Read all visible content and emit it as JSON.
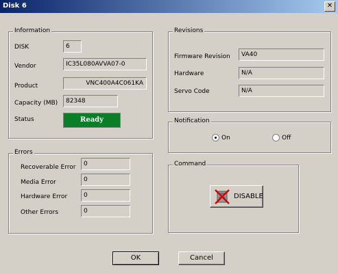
{
  "window": {
    "title": "Disk 6",
    "close_glyph": "✕"
  },
  "information": {
    "legend": "Information",
    "disk_label": "DISK",
    "disk_value": "6",
    "vendor_label": "Vendor",
    "vendor_value": "IC35L080AVVA07-0",
    "product_label": "Product",
    "product_value": "VNC400A4C061KA",
    "capacity_label": "Capacity (MB)",
    "capacity_value": "82348",
    "status_label": "Status",
    "status_value": "Ready",
    "status_color": "#0b7e28"
  },
  "errors": {
    "legend": "Errors",
    "items": [
      {
        "label": "Recoverable Error",
        "value": "0"
      },
      {
        "label": "Media Error",
        "value": "0"
      },
      {
        "label": "Hardware Error",
        "value": "0"
      },
      {
        "label": "Other Errors",
        "value": "0"
      }
    ]
  },
  "revisions": {
    "legend": "Revisions",
    "firmware_label": "Firmware Revision",
    "firmware_value": "VA40",
    "hardware_label": "Hardware",
    "hardware_value": "N/A",
    "servo_label": "Servo Code",
    "servo_value": "N/A"
  },
  "notification": {
    "legend": "Notification",
    "on_label": "On",
    "off_label": "Off",
    "selected": "On"
  },
  "command": {
    "legend": "Command",
    "disable_label": "DISABLE",
    "icon": "disable-disk-icon"
  },
  "buttons": {
    "ok": "OK",
    "cancel": "Cancel"
  }
}
